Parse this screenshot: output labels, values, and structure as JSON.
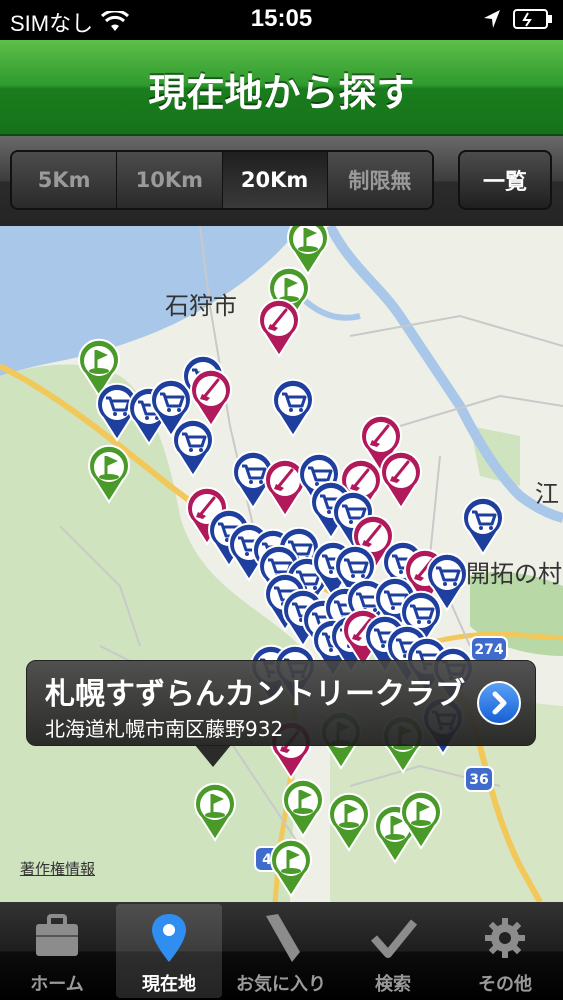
{
  "status": {
    "carrier": "SIMなし",
    "time": "15:05"
  },
  "nav": {
    "title": "現在地から探す"
  },
  "toolbar": {
    "distances": [
      "5Km",
      "10Km",
      "20Km",
      "制限無"
    ],
    "selected_distance": "20Km",
    "list_button": "一覧"
  },
  "map": {
    "labels": {
      "city1": "石狩市",
      "east": "江",
      "park": "開拓の村"
    },
    "routes": [
      "274",
      "36",
      "4"
    ],
    "credit": "著作権情報"
  },
  "callout": {
    "name": "札幌すずらんカントリークラブ",
    "address": "北海道札幌市南区藤野932"
  },
  "tabs": [
    {
      "label": "ホーム",
      "icon": "briefcase-icon"
    },
    {
      "label": "現在地",
      "icon": "map-pin-icon",
      "selected": true
    },
    {
      "label": "お気に入り",
      "icon": "bookmark-icon"
    },
    {
      "label": "検索",
      "icon": "checkmark-icon"
    },
    {
      "label": "その他",
      "icon": "gear-icon"
    }
  ],
  "colors": {
    "nav_green": "#2e9a2e",
    "pin_shop": "#1f3f9e",
    "pin_golf": "#4a9a2a",
    "pin_favorite": "#b0195a"
  }
}
